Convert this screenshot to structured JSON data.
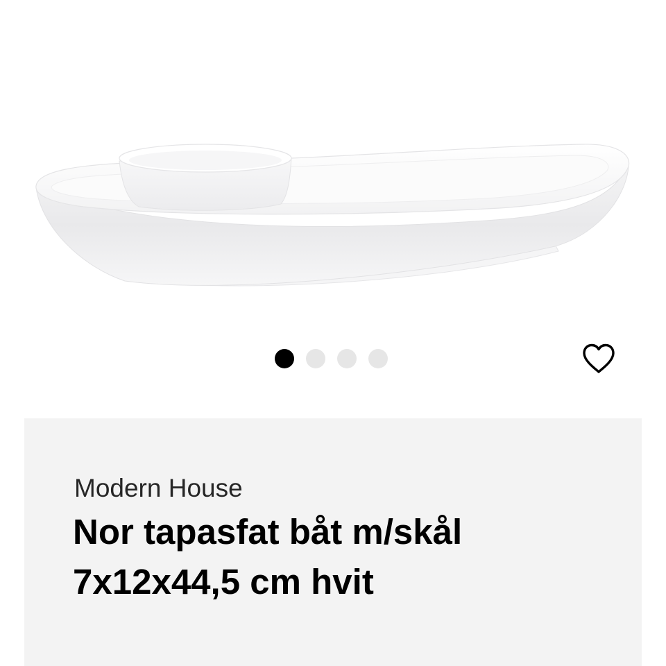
{
  "product": {
    "image_alt": "Nor tapasfat båt m/skål 7x12x44,5 cm hvit",
    "brand": "Modern House",
    "title": "Nor tapasfat båt m/skål 7x12x44,5 cm hvit"
  },
  "carousel": {
    "count": 4,
    "active_index": 0
  },
  "favorite": {
    "icon": "heart-outline-icon",
    "active": false
  },
  "colors": {
    "panel_background": "#f3f3f3",
    "dot_active": "#000000",
    "dot_inactive": "#e6e6e6",
    "text_primary": "#000000",
    "text_brand": "#262626"
  }
}
